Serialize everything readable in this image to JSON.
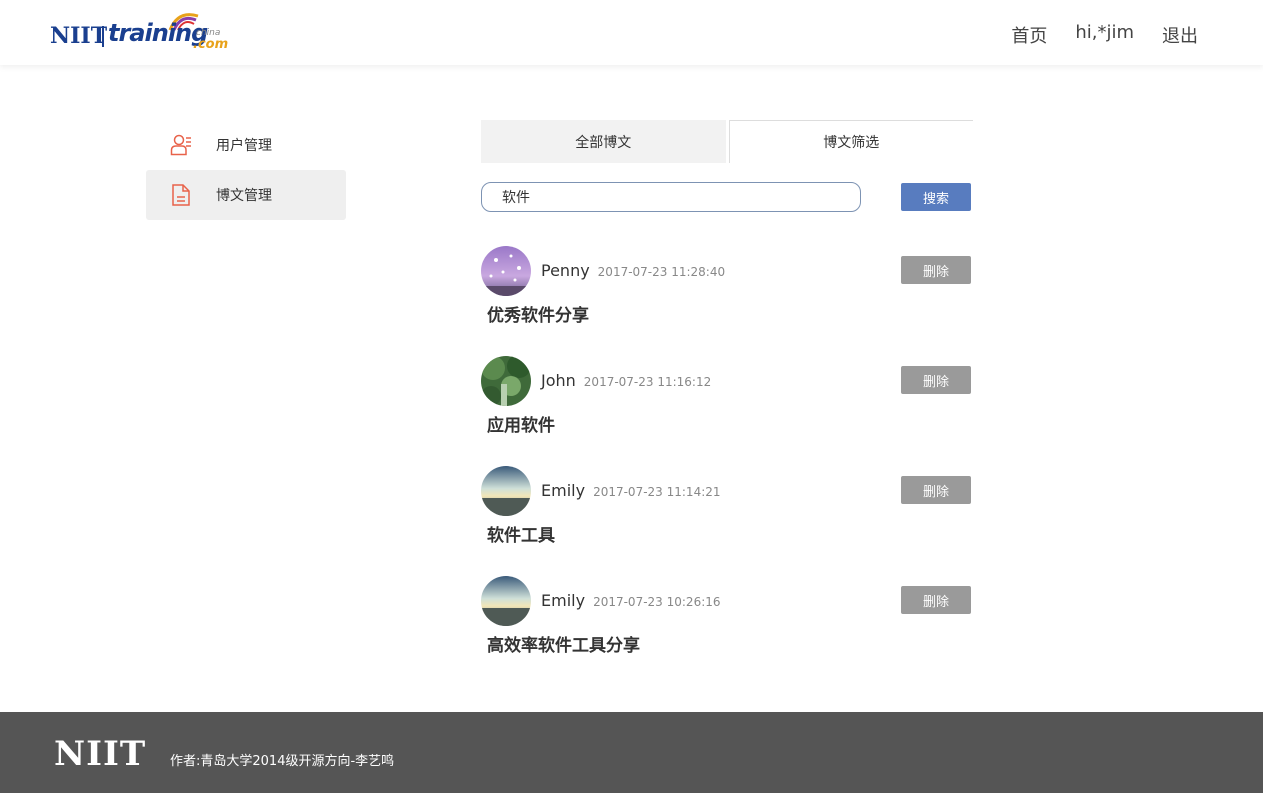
{
  "header": {
    "logo": {
      "niit": "NIIT",
      "training": "training",
      "china": "china",
      "com": ".com"
    },
    "nav": [
      {
        "label": "首页"
      },
      {
        "label": "hi,*jim"
      },
      {
        "label": "退出"
      }
    ]
  },
  "sidebar": {
    "items": [
      {
        "label": "用户管理",
        "icon": "user-manage-icon",
        "active": false
      },
      {
        "label": "博文管理",
        "icon": "document-icon",
        "active": true
      }
    ],
    "icon_color": "#e8624a"
  },
  "main": {
    "tabs": [
      {
        "label": "全部博文"
      },
      {
        "label": "博文筛选"
      }
    ],
    "search": {
      "value": "软件",
      "button_label": "搜索"
    },
    "posts": [
      {
        "author": "Penny",
        "time": "2017-07-23 11:28:40",
        "title": "优秀软件分享",
        "delete_label": "删除"
      },
      {
        "author": "John",
        "time": "2017-07-23 11:16:12",
        "title": "应用软件",
        "delete_label": "删除"
      },
      {
        "author": "Emily",
        "time": "2017-07-23 11:14:21",
        "title": "软件工具",
        "delete_label": "删除"
      },
      {
        "author": "Emily",
        "time": "2017-07-23 10:26:16",
        "title": "高效率软件工具分享",
        "delete_label": "删除"
      }
    ]
  },
  "footer": {
    "logo": "NIIT",
    "credit": "作者:青岛大学2014级开源方向-李艺鸣"
  },
  "colors": {
    "accent": "#587cbf",
    "delete": "#9a9a9a",
    "footer_bg": "#555555"
  }
}
